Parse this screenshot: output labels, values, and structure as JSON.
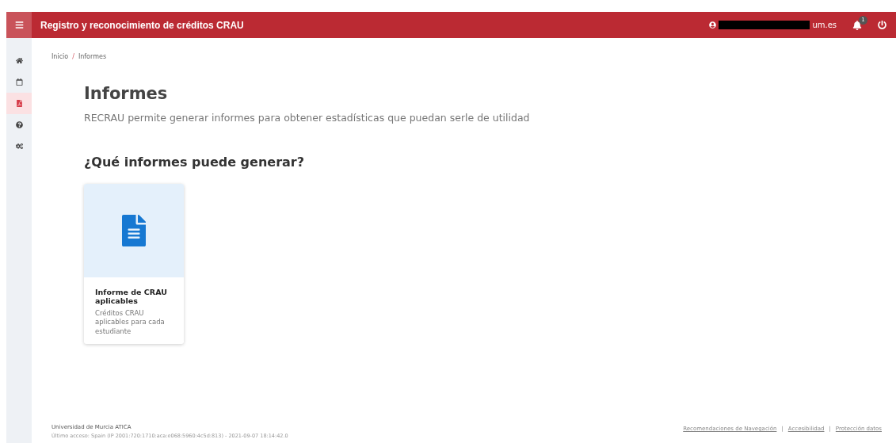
{
  "header": {
    "title": "Registro y reconocimiento de créditos CRAU",
    "user": "um.es",
    "notifications": "1"
  },
  "sidebar": {
    "items": [
      {
        "kind": "home",
        "selected": false
      },
      {
        "kind": "calendar",
        "selected": false
      },
      {
        "kind": "file",
        "selected": true
      },
      {
        "kind": "help",
        "selected": false
      },
      {
        "kind": "cogs",
        "selected": false
      }
    ]
  },
  "breadcrumb": {
    "items": [
      "Inicio",
      "Informes"
    ],
    "separator": "/"
  },
  "page": {
    "title": "Informes",
    "description": "RECRAU permite generar informes para obtener estadísticas que puedan serle de utilidad",
    "subtitle": "¿Qué informes puede generar?"
  },
  "cards": [
    {
      "title": "Informe de CRAU aplicables",
      "description": "Créditos CRAU aplicables para cada estudiante"
    }
  ],
  "footer": {
    "organization": "Universidad de Murcia ATICA",
    "last_access": "Último acceso: Spain (IP 2001:720:1710:aca:e068:5960:4c5d:813) - 2021-09-07 18:14:42.0",
    "links": [
      "Recomendaciones de Navegación",
      "Accesibilidad",
      "Protección datos"
    ],
    "link_separator": "|"
  }
}
